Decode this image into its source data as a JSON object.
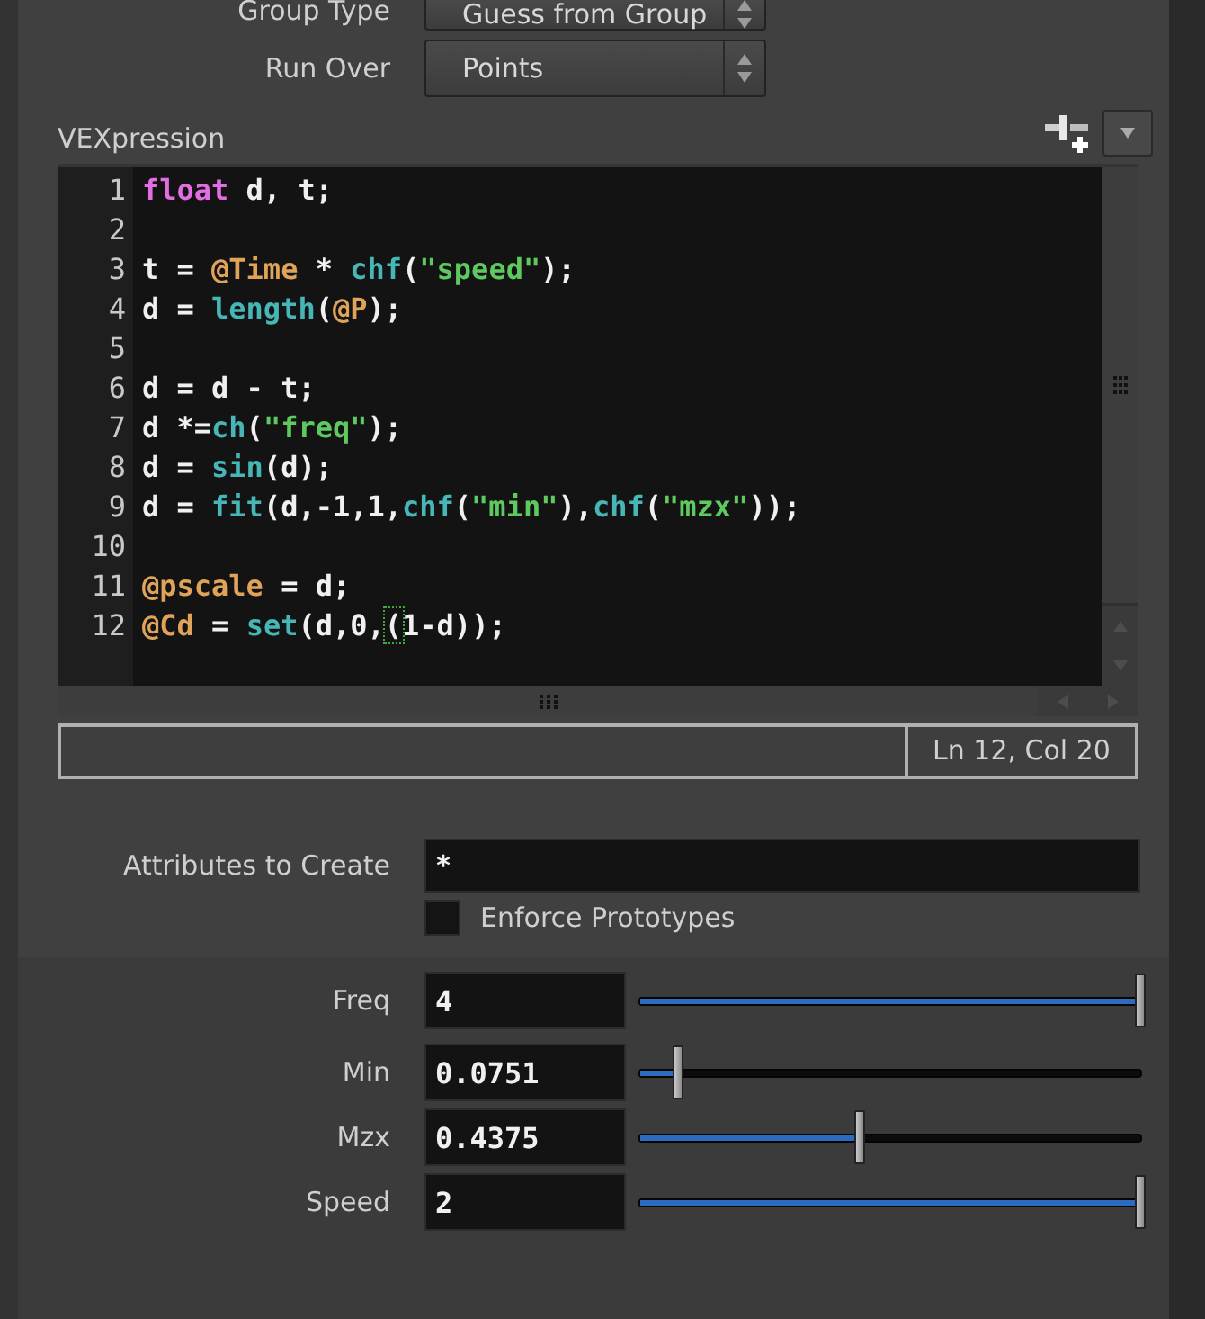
{
  "parameters_top": [
    {
      "label": "Group Type",
      "value": "Guess from Group"
    },
    {
      "label": "Run Over",
      "value": "Points"
    }
  ],
  "editor": {
    "label": "VEXpression",
    "lines": [
      {
        "number": "1",
        "tokens": [
          {
            "kind": "keyword",
            "text": "float"
          },
          {
            "kind": "plain",
            "text": " d, t;"
          }
        ]
      },
      {
        "number": "2"
      },
      {
        "number": "3",
        "tokens": [
          {
            "kind": "plain",
            "text": "t = "
          },
          {
            "kind": "attr",
            "text": "@Time"
          },
          {
            "kind": "plain",
            "text": " * "
          },
          {
            "kind": "func",
            "text": "chf"
          },
          {
            "kind": "plain",
            "text": "("
          },
          {
            "kind": "string",
            "text": "\"speed\""
          },
          {
            "kind": "plain",
            "text": ");"
          }
        ]
      },
      {
        "number": "4",
        "tokens": [
          {
            "kind": "plain",
            "text": "d = "
          },
          {
            "kind": "func",
            "text": "length"
          },
          {
            "kind": "plain",
            "text": "("
          },
          {
            "kind": "attr",
            "text": "@P"
          },
          {
            "kind": "plain",
            "text": ");"
          }
        ]
      },
      {
        "number": "5"
      },
      {
        "number": "6",
        "tokens": [
          {
            "kind": "plain",
            "text": "d = d - t;"
          }
        ]
      },
      {
        "number": "7",
        "tokens": [
          {
            "kind": "plain",
            "text": "d *="
          },
          {
            "kind": "func",
            "text": "ch"
          },
          {
            "kind": "plain",
            "text": "("
          },
          {
            "kind": "string",
            "text": "\"freq\""
          },
          {
            "kind": "plain",
            "text": ");"
          }
        ]
      },
      {
        "number": "8",
        "tokens": [
          {
            "kind": "plain",
            "text": "d = "
          },
          {
            "kind": "func",
            "text": "sin"
          },
          {
            "kind": "plain",
            "text": "(d);"
          }
        ]
      },
      {
        "number": "9",
        "tokens": [
          {
            "kind": "plain",
            "text": "d = "
          },
          {
            "kind": "func",
            "text": "fit"
          },
          {
            "kind": "plain",
            "text": "(d,-1,1,"
          },
          {
            "kind": "func",
            "text": "chf"
          },
          {
            "kind": "plain",
            "text": "("
          },
          {
            "kind": "string",
            "text": "\"min\""
          },
          {
            "kind": "plain",
            "text": "),"
          },
          {
            "kind": "func",
            "text": "chf"
          },
          {
            "kind": "plain",
            "text": "("
          },
          {
            "kind": "string",
            "text": "\"mzx\""
          },
          {
            "kind": "plain",
            "text": "));"
          }
        ]
      },
      {
        "number": "10"
      },
      {
        "number": "11",
        "tokens": [
          {
            "kind": "attr",
            "text": "@pscale"
          },
          {
            "kind": "plain",
            "text": " = d;"
          }
        ]
      },
      {
        "number": "12",
        "tokens": [
          {
            "kind": "attr",
            "text": "@Cd"
          },
          {
            "kind": "plain",
            "text": " = "
          },
          {
            "kind": "func",
            "text": "set"
          },
          {
            "kind": "plain",
            "text": "(d,0,"
          },
          {
            "kind": "bracket-match",
            "text": "("
          },
          {
            "kind": "plain",
            "text": "1-d));"
          }
        ]
      }
    ],
    "cursor_position": "Ln 12, Col 20"
  },
  "attributes_to_create": {
    "label": "Attributes to Create",
    "value": "*"
  },
  "enforce_prototypes": {
    "label": "Enforce Prototypes",
    "checked": false
  },
  "sliders": [
    {
      "label": "Freq",
      "value": "4",
      "level": 1
    },
    {
      "label": "Min",
      "value": "0.0751",
      "level": 0.075
    },
    {
      "label": "Mzx",
      "value": "0.4375",
      "level": 0.44
    },
    {
      "label": "Speed",
      "value": "2",
      "level": 1
    }
  ]
}
